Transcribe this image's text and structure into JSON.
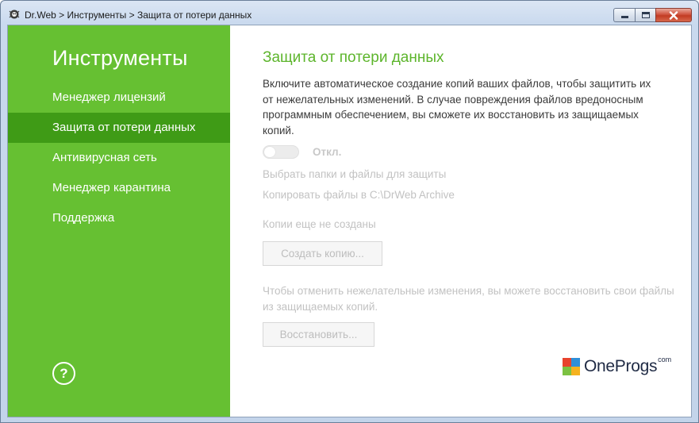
{
  "window": {
    "title": "Dr.Web > Инструменты > Защита от потери данных",
    "app_icon": "drweb-spider-icon",
    "controls": [
      "minimize-icon",
      "maximize-icon",
      "close-icon"
    ]
  },
  "sidebar": {
    "title": "Инструменты",
    "items": [
      {
        "label": "Менеджер лицензий",
        "active": false
      },
      {
        "label": "Защита от потери данных",
        "active": true
      },
      {
        "label": "Антивирусная сеть",
        "active": false
      },
      {
        "label": "Менеджер карантина",
        "active": false
      },
      {
        "label": "Поддержка",
        "active": false
      }
    ],
    "help_label": "?",
    "colors": {
      "background": "#66c032",
      "active": "#3f9b16"
    }
  },
  "main": {
    "title": "Защита от потери данных",
    "description": "Включите автоматическое создание копий ваших файлов, чтобы защитить их от нежелательных изменений. В случае повреждения файлов вредоносным программным обеспечением, вы сможете их восстановить из защищаемых копий.",
    "toggle": {
      "state": "off",
      "label": "Откл."
    },
    "select_files_link": "Выбрать папки и файлы для защиты",
    "copy_location": "Копировать файлы в C:\\DrWeb Archive",
    "copies_status": "Копии еще не созданы",
    "create_copy_button": "Создать копию...",
    "restore_hint": "Чтобы отменить нежелательные изменения, вы можете восстановить свои файлы из защищаемых копий.",
    "restore_button": "Восстановить...",
    "accent_color": "#5db52c"
  },
  "watermark": {
    "name": "OneProgs",
    "suffix": "com",
    "colors": [
      "#e8432d",
      "#2f8fd8",
      "#7cc242",
      "#f5b21f"
    ]
  }
}
